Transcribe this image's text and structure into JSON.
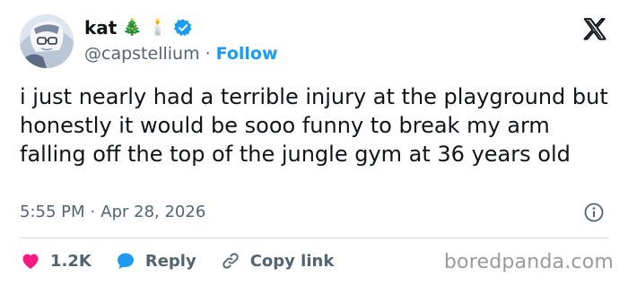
{
  "author": {
    "display_name": "kat",
    "name_emojis": [
      "🎄",
      "🕯️"
    ],
    "handle": "@capstellium",
    "separator": "·",
    "follow_label": "Follow"
  },
  "tweet": {
    "text": "i just nearly had a terrible injury at the playground but honestly it would be sooo funny to break my arm falling off the top of the jungle gym at 36 years old",
    "time": "5:55 PM",
    "separator": "·",
    "date": "Apr 28, 2026"
  },
  "actions": {
    "like_count": "1.2K",
    "reply_label": "Reply",
    "copy_link_label": "Copy link"
  },
  "watermark": "boredpanda.com",
  "colors": {
    "accent": "#1d9bf0",
    "like": "#f91880",
    "text": "#0f1419",
    "muted": "#536471"
  },
  "icons": [
    "verified-badge-icon",
    "x-logo-icon",
    "info-icon",
    "heart-icon",
    "reply-bubble-icon",
    "link-icon"
  ]
}
